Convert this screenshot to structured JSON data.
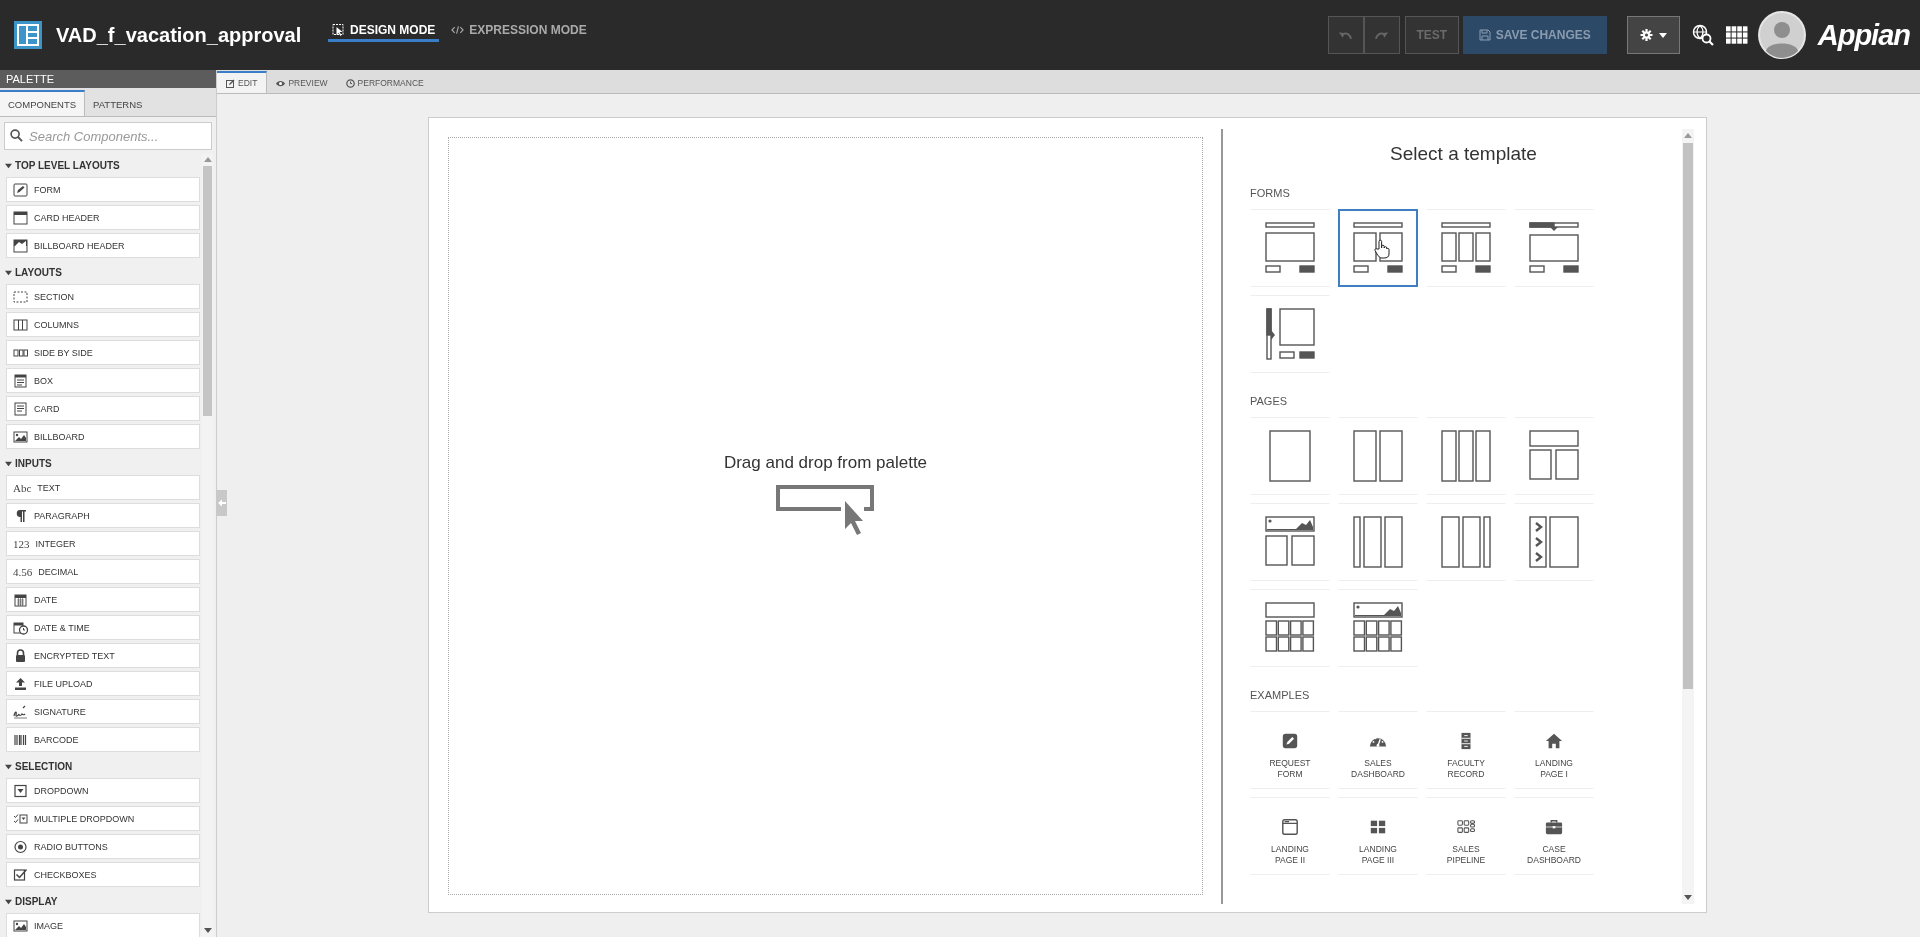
{
  "app": {
    "title": "VAD_f_vacation_approval",
    "modes": [
      {
        "label": "DESIGN MODE",
        "kind": "design",
        "selected": true
      },
      {
        "label": "EXPRESSION MODE",
        "kind": "expression",
        "selected": false
      }
    ],
    "toolbar": [
      {
        "kind": "undo",
        "disabled": true
      },
      {
        "kind": "redo",
        "disabled": true
      },
      {
        "kind": "test",
        "label": "TEST",
        "disabled": true
      },
      {
        "kind": "save",
        "label": "SAVE CHANGES",
        "disabled": true
      },
      {
        "kind": "settings",
        "disabled": false
      }
    ],
    "brand": "Appian"
  },
  "palette": {
    "title": "PALETTE",
    "tabs": [
      {
        "label": "COMPONENTS",
        "selected": true
      },
      {
        "label": "PATTERNS",
        "selected": false
      }
    ],
    "search": {
      "placeholder": "Search Components..."
    },
    "groups": [
      {
        "label": "TOP LEVEL LAYOUTS",
        "expanded": true,
        "items": [
          {
            "label": "FORM",
            "kind": "form"
          },
          {
            "label": "CARD HEADER",
            "kind": "card-header"
          },
          {
            "label": "BILLBOARD HEADER",
            "kind": "billboard-header"
          }
        ]
      },
      {
        "label": "LAYOUTS",
        "expanded": true,
        "items": [
          {
            "label": "SECTION",
            "kind": "section"
          },
          {
            "label": "COLUMNS",
            "kind": "columns"
          },
          {
            "label": "SIDE BY SIDE",
            "kind": "side-by-side"
          },
          {
            "label": "BOX",
            "kind": "box"
          },
          {
            "label": "CARD",
            "kind": "card"
          },
          {
            "label": "BILLBOARD",
            "kind": "billboard"
          }
        ]
      },
      {
        "label": "INPUTS",
        "expanded": true,
        "items": [
          {
            "label": "TEXT",
            "kind": "glyph",
            "glyph": "Abc"
          },
          {
            "label": "PARAGRAPH",
            "kind": "paragraph"
          },
          {
            "label": "INTEGER",
            "kind": "glyph",
            "glyph": "123"
          },
          {
            "label": "DECIMAL",
            "kind": "glyph",
            "glyph": "4.56"
          },
          {
            "label": "DATE",
            "kind": "date"
          },
          {
            "label": "DATE & TIME",
            "kind": "date-time"
          },
          {
            "label": "ENCRYPTED TEXT",
            "kind": "lock"
          },
          {
            "label": "FILE UPLOAD",
            "kind": "upload"
          },
          {
            "label": "SIGNATURE",
            "kind": "signature"
          },
          {
            "label": "BARCODE",
            "kind": "barcode"
          }
        ]
      },
      {
        "label": "SELECTION",
        "expanded": true,
        "items": [
          {
            "label": "DROPDOWN",
            "kind": "dropdown"
          },
          {
            "label": "MULTIPLE DROPDOWN",
            "kind": "multi-dropdown"
          },
          {
            "label": "RADIO BUTTONS",
            "kind": "radio"
          },
          {
            "label": "CHECKBOXES",
            "kind": "checkbox"
          }
        ]
      },
      {
        "label": "DISPLAY",
        "expanded": true,
        "items": [
          {
            "label": "IMAGE",
            "kind": "image"
          }
        ]
      }
    ]
  },
  "editor_tabs": [
    {
      "label": "EDIT",
      "kind": "edit",
      "selected": true
    },
    {
      "label": "PREVIEW",
      "kind": "preview",
      "selected": false
    },
    {
      "label": "PERFORMANCE",
      "kind": "performance",
      "selected": false
    }
  ],
  "canvas": {
    "message": "Drag and drop from palette"
  },
  "templates": {
    "title": "Select a template",
    "sections": [
      {
        "label": "FORMS",
        "items": [
          {
            "kind": "form-one",
            "selected": false
          },
          {
            "kind": "form-two",
            "selected": true
          },
          {
            "kind": "form-three",
            "selected": false
          },
          {
            "kind": "form-wizard",
            "selected": false
          },
          {
            "kind": "form-sidebar",
            "selected": false
          }
        ]
      },
      {
        "label": "PAGES",
        "items": [
          {
            "kind": "page-one",
            "selected": false
          },
          {
            "kind": "page-two",
            "selected": false
          },
          {
            "kind": "page-three",
            "selected": false
          },
          {
            "kind": "page-header-two",
            "selected": false
          },
          {
            "kind": "page-billboard-two",
            "selected": false
          },
          {
            "kind": "page-narrow-two",
            "selected": false
          },
          {
            "kind": "page-two-narrow",
            "selected": false
          },
          {
            "kind": "page-steps",
            "selected": false
          },
          {
            "kind": "page-grid",
            "selected": false
          },
          {
            "kind": "page-billboard-grid",
            "selected": false
          }
        ]
      },
      {
        "label": "EXAMPLES",
        "items": [
          {
            "kind": "pencil",
            "label": "REQUEST\nFORM",
            "selected": false
          },
          {
            "kind": "gauge",
            "label": "SALES\nDASHBOARD",
            "selected": false
          },
          {
            "kind": "cabinet",
            "label": "FACULTY\nRECORD",
            "selected": false
          },
          {
            "kind": "house",
            "label": "LANDING\nPAGE I",
            "selected": false
          },
          {
            "kind": "window",
            "label": "LANDING\nPAGE II",
            "selected": false
          },
          {
            "kind": "tiles",
            "label": "LANDING\nPAGE III",
            "selected": false
          },
          {
            "kind": "pipeline",
            "label": "SALES\nPIPELINE",
            "selected": false
          },
          {
            "kind": "briefcase",
            "label": "CASE\nDASHBOARD",
            "selected": false
          }
        ]
      }
    ]
  }
}
